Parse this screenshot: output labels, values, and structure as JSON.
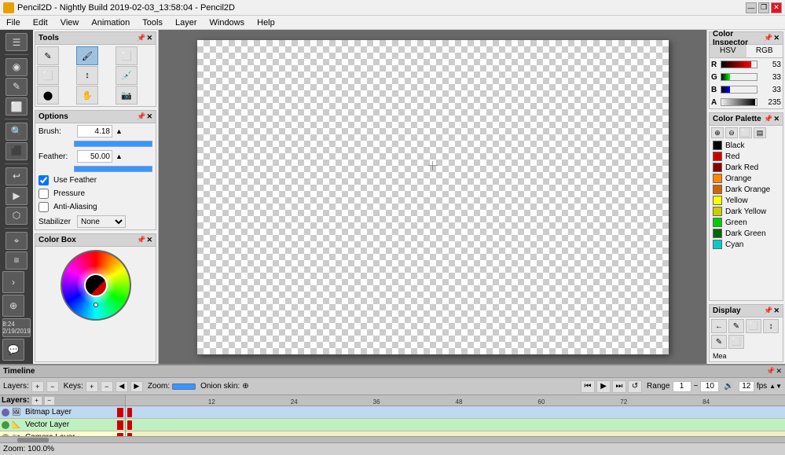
{
  "titlebar": {
    "icon": "✏",
    "title": "Pencil2D - Nightly Build 2019-02-03_13:58:04 - Pencil2D",
    "min": "—",
    "max": "❐",
    "close": "✕"
  },
  "menubar": {
    "items": [
      "File",
      "Edit",
      "View",
      "Animation",
      "Tools",
      "Layer",
      "Windows",
      "Help"
    ]
  },
  "left_toolbar": {
    "buttons": [
      "⬜",
      "✎",
      "🖌",
      "⬜",
      "↩",
      "✂",
      "⭕",
      "✏",
      "🔍",
      "🖊",
      "⬜"
    ]
  },
  "tools_panel": {
    "title": "Tools",
    "tools": [
      "⬜",
      "✎",
      "🖌",
      "↩",
      "↕",
      "✂",
      "⭕",
      "✏",
      "🔍",
      "🖊",
      "⬜",
      "▶"
    ]
  },
  "options_panel": {
    "title": "Options",
    "brush_label": "Brush:",
    "brush_value": "4.18",
    "feather_label": "Feather:",
    "feather_value": "50.00",
    "use_feather": "Use Feather",
    "pressure": "Pressure",
    "anti_aliasing": "Anti-Aliasing",
    "stabilizer_label": "Stabilizer",
    "stabilizer_value": "None"
  },
  "colorbox_panel": {
    "title": "Color Box"
  },
  "color_inspector": {
    "title": "Color Inspector",
    "tab_hsv": "HSV",
    "tab_rgb": "RGB",
    "r_label": "R",
    "r_value": "53",
    "g_label": "G",
    "g_value": "33",
    "b_label": "B",
    "b_value": "33",
    "a_label": "A",
    "a_value": "235"
  },
  "color_palette": {
    "title": "Color Palette",
    "colors": [
      {
        "name": "Black",
        "hex": "#000000"
      },
      {
        "name": "Red",
        "hex": "#cc0000"
      },
      {
        "name": "Dark Red",
        "hex": "#880000"
      },
      {
        "name": "Orange",
        "hex": "#ff8800"
      },
      {
        "name": "Dark Orange",
        "hex": "#cc6600"
      },
      {
        "name": "Yellow",
        "hex": "#ffff00"
      },
      {
        "name": "Dark Yellow",
        "hex": "#cccc00"
      },
      {
        "name": "Green",
        "hex": "#00cc00"
      },
      {
        "name": "Dark Green",
        "hex": "#006600"
      },
      {
        "name": "Cyan",
        "hex": "#00cccc"
      }
    ]
  },
  "display_panel": {
    "title": "Display",
    "icons": [
      "←",
      "✎",
      "⬜",
      "↕",
      "✎",
      "⬜"
    ]
  },
  "canvas": {
    "zoom_text": "Zoom: 100.0%"
  },
  "timeline": {
    "title": "Timeline",
    "layers_label": "Layers:",
    "keys_label": "Keys:",
    "zoom_label": "Zoom:",
    "onion_label": "Onion skin:",
    "range_label": "Range",
    "range_start": "1",
    "range_end": "10",
    "fps_value": "12",
    "fps_label": "fps",
    "layers": [
      {
        "name": "Bitmap Layer",
        "type": "bitmap",
        "icon": "🖼"
      },
      {
        "name": "Vector Layer",
        "type": "vector",
        "icon": "📐"
      },
      {
        "name": "Camera Layer",
        "type": "camera",
        "icon": "📷"
      }
    ],
    "ruler_marks": [
      "12",
      "24",
      "36",
      "48",
      "60",
      "72",
      "84"
    ]
  },
  "statusbar": {
    "zoom": "Zoom: 100.0%"
  }
}
